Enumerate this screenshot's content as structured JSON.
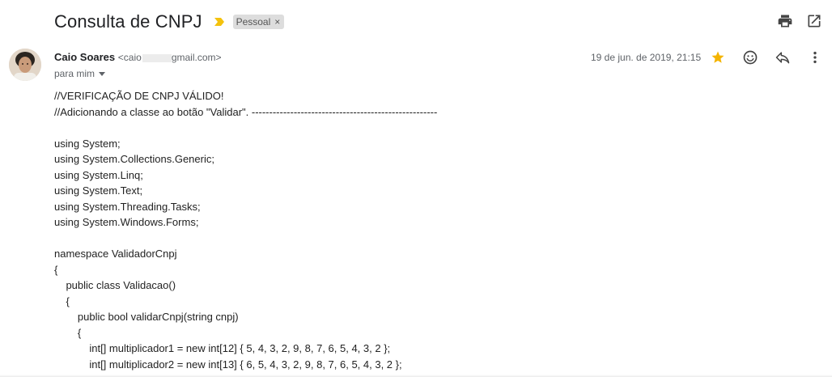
{
  "email": {
    "subject": "Consulta de CNPJ",
    "label": "Pessoal",
    "label_close": "×",
    "sender_name": "Caio Soares",
    "sender_email_prefix": "<caio",
    "sender_email_suffix": "gmail.com>",
    "recipient": "para mim",
    "date": "19 de jun. de 2019, 21:15",
    "starred": true
  },
  "colors": {
    "importance": "#f4c20d",
    "star": "#f4b400",
    "icon": "#5f6368"
  },
  "icons": {
    "top": [
      "print-icon",
      "open-in-new-window-icon"
    ],
    "message": [
      "star-icon",
      "emoji-reaction-icon",
      "reply-icon",
      "more-vert-icon"
    ]
  },
  "body_lines": [
    "//VERIFICAÇÃO DE CNPJ VÁLIDO!",
    "//Adicionando a classe ao botão \"Validar\". -----------------------------------------------------",
    "",
    "using System;",
    "using System.Collections.Generic;",
    "using System.Linq;",
    "using System.Text;",
    "using System.Threading.Tasks;",
    "using System.Windows.Forms;",
    "",
    "namespace ValidadorCnpj",
    "{",
    "    public class Validacao()",
    "    {",
    "        public bool validarCnpj(string cnpj)",
    "        {",
    "            int[] multiplicador1 = new int[12] { 5, 4, 3, 2, 9, 8, 7, 6, 5, 4, 3, 2 };",
    "            int[] multiplicador2 = new int[13] { 6, 5, 4, 3, 2, 9, 8, 7, 6, 5, 4, 3, 2 };"
  ]
}
